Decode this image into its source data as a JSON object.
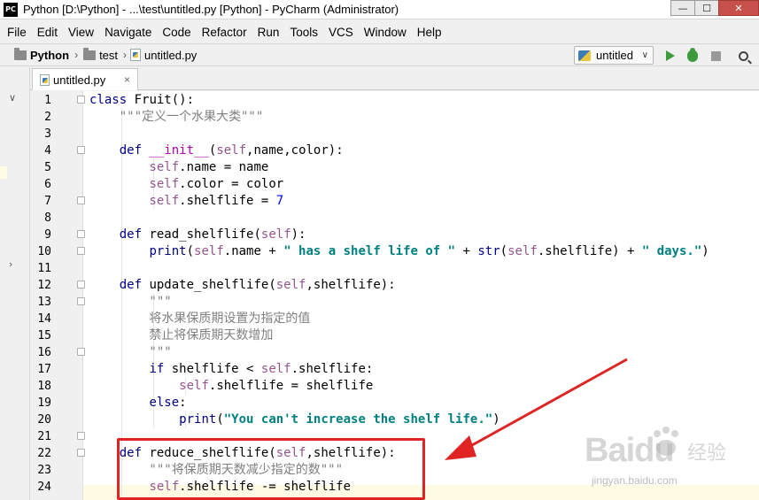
{
  "window": {
    "title": "Python [D:\\Python] - ...\\test\\untitled.py [Python] - PyCharm (Administrator)",
    "app_icon_text": "PC",
    "min_glyph": "—",
    "max_glyph": "☐",
    "close_glyph": "✕"
  },
  "menu": [
    "File",
    "Edit",
    "View",
    "Navigate",
    "Code",
    "Refactor",
    "Run",
    "Tools",
    "VCS",
    "Window",
    "Help"
  ],
  "breadcrumb": {
    "project": "Python",
    "folder": "test",
    "file": "untitled.py"
  },
  "run_config": {
    "label": "untitled",
    "dropdown_glyph": "∨"
  },
  "tab": {
    "label": "untitled.py",
    "close_glyph": "×"
  },
  "editor": {
    "line_numbers": [
      "1",
      "2",
      "3",
      "4",
      "5",
      "6",
      "7",
      "8",
      "9",
      "10",
      "11",
      "12",
      "13",
      "14",
      "15",
      "16",
      "17",
      "18",
      "19",
      "20",
      "21",
      "22",
      "23",
      "24"
    ],
    "lines": [
      "class Fruit():",
      "    \"\"\"定义一个水果大类\"\"\"",
      "",
      "    def __init__(self,name,color):",
      "        self.name = name",
      "        self.color = color",
      "        self.shelflife = 7",
      "",
      "    def read_shelflife(self):",
      "        print(self.name + \" has a shelf life of \" + str(self.shelflife) + \" days.\")",
      "",
      "    def update_shelflife(self,shelflife):",
      "        \"\"\"",
      "        将水果保质期设置为指定的值",
      "        禁止将保质期天数增加",
      "        \"\"\"",
      "        if shelflife < self.shelflife:",
      "            self.shelflife = shelflife",
      "        else:",
      "            print(\"You can't increase the shelf life.\")",
      "",
      "    def reduce_shelflife(self,shelflife):",
      "        \"\"\"将保质期天数减少指定的数\"\"\"",
      "        self.shelflife -= shelflife"
    ]
  },
  "watermark": {
    "brand": "Baidu",
    "brand_cn": "经验",
    "url": "jingyan.baidu.com"
  },
  "colors": {
    "keyword": "#000080",
    "self": "#94558d",
    "string": "#008080",
    "docstring": "#808080",
    "annotation": "#e02424"
  }
}
